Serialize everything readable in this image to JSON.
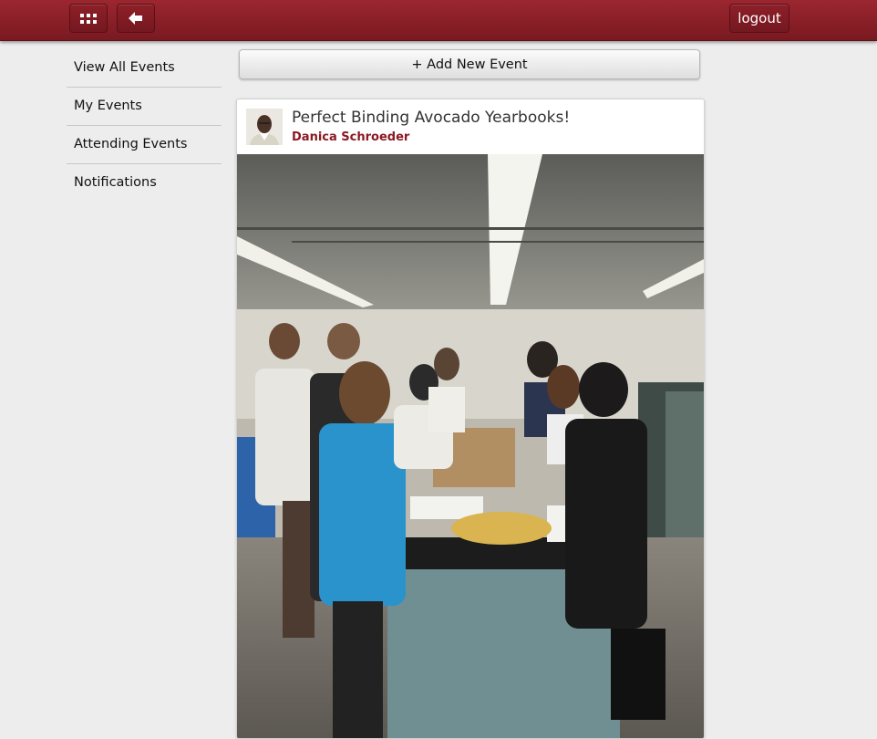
{
  "header": {
    "apps_icon": "grid-icon",
    "back_icon": "arrow-left-icon",
    "logout_label": "logout"
  },
  "sidebar": {
    "items": [
      {
        "label": "View All Events"
      },
      {
        "label": "My Events"
      },
      {
        "label": "Attending Events"
      },
      {
        "label": "Notifications"
      }
    ]
  },
  "main": {
    "add_event_label": "+ Add New Event",
    "event": {
      "title": "Perfect Binding Avocado Yearbooks!",
      "author": "Danica Schroeder"
    }
  },
  "colors": {
    "topbar": "#8b1f28",
    "author": "#8b1a22",
    "background": "#ededed"
  }
}
